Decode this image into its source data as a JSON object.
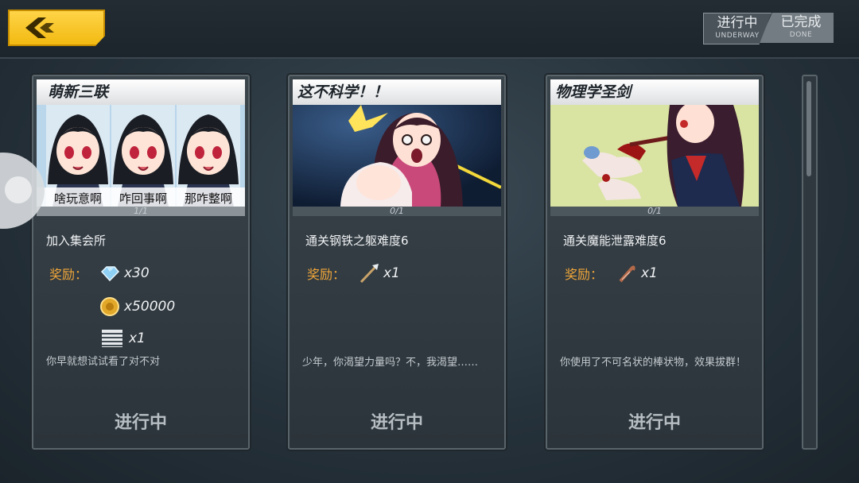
{
  "header": {
    "back_label": "",
    "tabs": [
      {
        "cn": "进行中",
        "en": "UNDERWAY"
      },
      {
        "cn": "已完成",
        "en": "DONE"
      }
    ]
  },
  "cards": [
    {
      "title": "萌新三联",
      "captions": [
        "啥玩意啊",
        "咋回事啊",
        "那咋整啊"
      ],
      "progress": "1/1",
      "progress_fraction": 1.0,
      "mission": "加入集会所",
      "reward_label": "奖励：",
      "rewards": [
        {
          "icon": "crystal-icon",
          "amount": "x30"
        },
        {
          "icon": "gold-coin-icon",
          "amount": "x50000"
        },
        {
          "icon": "ticket-icon",
          "amount": "x1"
        }
      ],
      "desc": "你早就想试试看了对不对",
      "status": "进行中"
    },
    {
      "title": "这不科学！！",
      "progress": "0/1",
      "progress_fraction": 0.0,
      "mission": "通关钢铁之躯难度6",
      "reward_label": "奖励：",
      "rewards": [
        {
          "icon": "spear-icon",
          "amount": "x1"
        }
      ],
      "desc": "少年，你渴望力量吗？不，我渴望……",
      "status": "进行中"
    },
    {
      "title": "物理学圣剑",
      "progress": "0/1",
      "progress_fraction": 0.0,
      "mission": "通关魔能泄露难度6",
      "reward_label": "奖励：",
      "rewards": [
        {
          "icon": "crowbar-icon",
          "amount": "x1"
        }
      ],
      "desc": "你使用了不可名状的棒状物，效果拔群！",
      "status": "进行中"
    }
  ],
  "colors": {
    "accent_yellow": "#f2b90f",
    "reward_label": "#f0a63a"
  }
}
